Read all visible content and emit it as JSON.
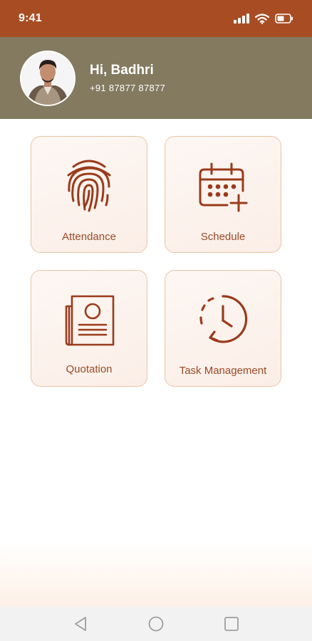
{
  "status_bar": {
    "time": "9:41"
  },
  "header": {
    "greeting": "Hi, Badhri",
    "phone": "+91 87877 87877"
  },
  "tiles": [
    {
      "label": "Attendance",
      "icon": "fingerprint-icon"
    },
    {
      "label": "Schedule",
      "icon": "calendar-add-icon"
    },
    {
      "label": "Quotation",
      "icon": "document-icon"
    },
    {
      "label": "Task Management",
      "icon": "clock-history-icon"
    }
  ],
  "nav": {
    "back": "back-icon",
    "home": "home-icon",
    "recents": "recents-icon"
  },
  "colors": {
    "status_bar": "#a84d23",
    "header": "#837a60",
    "accent": "#9a4a27",
    "tile_border": "#e8c3a2"
  }
}
